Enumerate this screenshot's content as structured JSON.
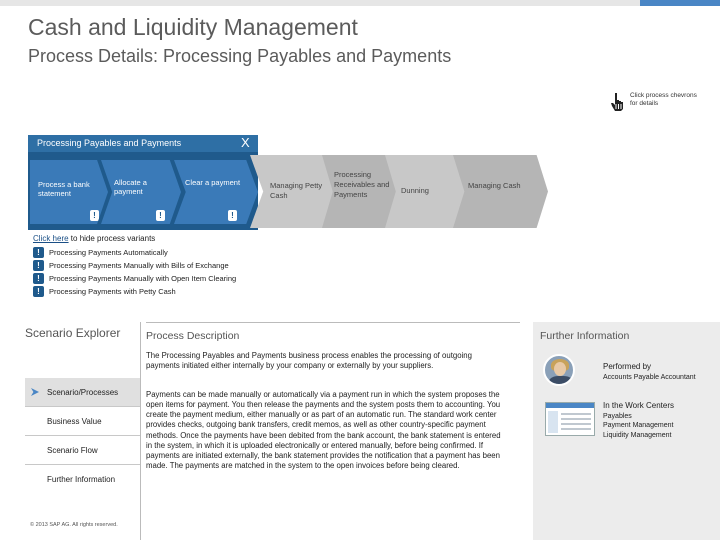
{
  "header": {
    "title": "Cash and Liquidity Management",
    "subtitle": "Process Details: Processing Payables and Payments"
  },
  "hint": {
    "text": "Click process chevrons for details",
    "icon": "hand-pointer-icon"
  },
  "process_flow": {
    "expanded_title": "Processing Payables and Payments",
    "close_label": "X",
    "variants": [
      {
        "label": "Process a bank statement",
        "marker": "!"
      },
      {
        "label": "Allocate a payment",
        "marker": "!"
      },
      {
        "label": "Clear a payment",
        "marker": "!"
      }
    ],
    "chevrons": [
      {
        "label": "Managing Petty Cash"
      },
      {
        "label": "Processing Receivables and Payments"
      },
      {
        "label": "Dunning"
      },
      {
        "label": "Managing Cash"
      }
    ]
  },
  "hide_variants": {
    "link": "Click here",
    "text": " to hide process variants"
  },
  "variant_list": [
    {
      "label": "Processing Payments Automatically",
      "marker": "!"
    },
    {
      "label": "Processing Payments Manually with Bills of Exchange",
      "marker": "!"
    },
    {
      "label": "Processing Payments Manually with Open Item Clearing",
      "marker": "!"
    },
    {
      "label": "Processing Payments with Petty Cash",
      "marker": "!"
    }
  ],
  "scenario_explorer": {
    "title": "Scenario Explorer",
    "items": [
      {
        "label": "Scenario/Processes"
      },
      {
        "label": "Business Value"
      },
      {
        "label": "Scenario Flow"
      },
      {
        "label": "Further Information"
      }
    ],
    "copyright": "© 2013 SAP AG. All rights reserved."
  },
  "process_description": {
    "heading": "Process Description",
    "intro": "The Processing Payables and Payments business process enables the processing of outgoing payments initiated either internally by your company or externally by your suppliers.",
    "body": "Payments can be made manually or automatically via a payment run in which the system proposes the open items for payment. You then release the payments and the system posts them to accounting. You create the payment medium, either manually or as part of an automatic run. The standard work center provides checks, outgoing bank transfers, credit memos, as well as other country-specific payment methods. Once the payments have been debited from the bank account, the bank statement is entered in the system, in which it is uploaded electronically or entered manually, before being confirmed. If payments are initiated externally, the bank statement provides the notification that a payment has been made. The payments are matched in the system to the open invoices before being cleared."
  },
  "further_information": {
    "heading": "Further Information",
    "performed_by_label": "Performed by",
    "performed_by_value": "Accounts Payable Accountant",
    "work_centers_label": "In the Work Centers",
    "work_centers": [
      "Payables",
      "Payment Management",
      "Liquidity Management"
    ]
  },
  "colors": {
    "accent": "#4a86c5",
    "expanded_bg": "#1f5a8c",
    "chevron_grey": "#c8c8c8"
  }
}
